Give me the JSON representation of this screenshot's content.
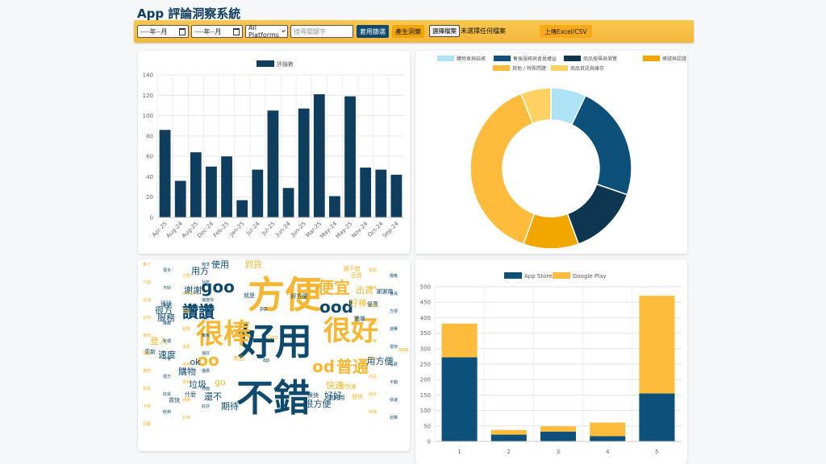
{
  "app": {
    "title": "App 評論洞察系統"
  },
  "toolbar": {
    "date_from": "----年--月",
    "date_to": "----年--月",
    "platform_select": "All Platforms",
    "search_placeholder": "搜尋關鍵字",
    "apply_filter_label": "套用篩選",
    "generate_insight_label": "產生洞察",
    "choose_file_label": "選擇檔案",
    "file_status": "未選擇任何檔案",
    "upload_label": "上傳Excel/CSV"
  },
  "chart_data": [
    {
      "type": "bar",
      "categories": [
        "Apr-25",
        "Aug-24",
        "Aug-25",
        "Dec-24",
        "Feb-25",
        "Jan-25",
        "Jul-24",
        "Jul-25",
        "Jun-24",
        "Jun-25",
        "Mar-25",
        "May-24",
        "May-25",
        "Nov-24",
        "Oct-24",
        "Sep-24"
      ],
      "series": [
        {
          "name": "評論數",
          "values": [
            86,
            36,
            64,
            50,
            60,
            17,
            47,
            105,
            29,
            107,
            121,
            21,
            119,
            49,
            47,
            42
          ]
        }
      ],
      "ylim": [
        0,
        140
      ],
      "yticks": [
        "0",
        "20",
        "40",
        "60",
        "80",
        "100",
        "120",
        "140"
      ],
      "legend": "top",
      "colors": {
        "bar": "#0e3d5e"
      }
    },
    {
      "type": "pie",
      "labels": [
        "購物車與結帳",
        "售後服務與會員權益",
        "商品搜尋與瀏覽",
        "帳號與認證",
        "其他 / 特殊問題",
        "商品資訊與庫存"
      ],
      "values": [
        7,
        23,
        14,
        11,
        38,
        6
      ],
      "colors": [
        "#aee3f5",
        "#0d5079",
        "#0d3750",
        "#f2a600",
        "#ffbb3c",
        "#ffd263"
      ],
      "legend": "top"
    },
    {
      "type": "bar",
      "stacked": true,
      "categories": [
        "1",
        "2",
        "3",
        "4",
        "5"
      ],
      "series": [
        {
          "name": "App Store",
          "values": [
            272,
            22,
            32,
            17,
            155
          ]
        },
        {
          "name": "Google Play",
          "values": [
            109,
            15,
            17,
            44,
            316
          ]
        }
      ],
      "ylim": [
        0,
        500
      ],
      "yticks": [
        "0",
        "50",
        "100",
        "150",
        "200",
        "250",
        "300",
        "350",
        "400",
        "450",
        "500"
      ],
      "legend": "top",
      "colors": {
        "App Store": "#0d5079",
        "Google Play": "#ffbb3c"
      }
    }
  ],
  "wordcloud": {
    "colors": {
      "dark": "#0d4a6d",
      "gold": "#f7b733"
    },
    "words": [
      {
        "t": "不錯",
        "s": 5,
        "c": "dark"
      },
      {
        "t": "好用",
        "s": 5,
        "c": "dark"
      },
      {
        "t": "方便",
        "s": 5,
        "c": "gold"
      },
      {
        "t": "很好",
        "s": 4,
        "c": "gold"
      },
      {
        "t": "很棒",
        "s": 4,
        "c": "gold"
      },
      {
        "t": "讚讚",
        "s": 3,
        "c": "dark"
      },
      {
        "t": "ood",
        "s": 3,
        "c": "dark"
      },
      {
        "t": "oo",
        "s": 3,
        "c": "gold"
      },
      {
        "t": "便宜",
        "s": 3,
        "c": "gold"
      },
      {
        "t": "od",
        "s": 3,
        "c": "gold"
      },
      {
        "t": "普通",
        "s": 3,
        "c": "gold"
      },
      {
        "t": "goo",
        "s": 3,
        "c": "dark"
      },
      {
        "t": "快速",
        "s": 2,
        "c": "gold"
      },
      {
        "t": "ok",
        "s": 2,
        "c": "dark"
      },
      {
        "t": "go",
        "s": 2,
        "c": "gold"
      },
      {
        "t": "謝謝",
        "s": 2,
        "c": "dark"
      },
      {
        "t": "垃圾",
        "s": 2,
        "c": "dark"
      },
      {
        "t": "購物",
        "s": 2,
        "c": "dark"
      },
      {
        "t": "很方",
        "s": 2,
        "c": "dark"
      },
      {
        "t": "好棒",
        "s": 2,
        "c": "gold"
      },
      {
        "t": "用方便",
        "s": 2,
        "c": "dark"
      },
      {
        "t": "服務",
        "s": 2,
        "c": "dark"
      },
      {
        "t": "登入",
        "s": 2,
        "c": "gold"
      },
      {
        "t": "速度",
        "s": 2,
        "c": "dark"
      },
      {
        "t": "還不",
        "s": 2,
        "c": "dark"
      },
      {
        "t": "期待",
        "s": 2,
        "c": "dark"
      },
      {
        "t": "好好",
        "s": 2,
        "c": "dark"
      },
      {
        "t": "很方便",
        "s": 2,
        "c": "dark"
      },
      {
        "t": "出貨",
        "s": 2,
        "c": "gold"
      },
      {
        "t": "使用",
        "s": 2,
        "c": "dark"
      },
      {
        "t": "到貨",
        "s": 2,
        "c": "gold"
      },
      {
        "t": "用方",
        "s": 2,
        "c": "dark"
      },
      {
        "t": "很好用",
        "s": 1,
        "c": "dark"
      },
      {
        "t": "便快速",
        "s": 1,
        "c": "gold"
      },
      {
        "t": "更新",
        "s": 1,
        "c": "dark"
      },
      {
        "t": "優惠",
        "s": 1,
        "c": "dark"
      },
      {
        "t": "商品",
        "s": 1,
        "c": "gold"
      },
      {
        "t": "簡單",
        "s": 1,
        "c": "dark"
      },
      {
        "t": "謝謝商",
        "s": 1,
        "c": "dark"
      },
      {
        "t": "什麼",
        "s": 1,
        "c": "dark"
      },
      {
        "t": "品質",
        "s": 1,
        "c": "gold"
      },
      {
        "t": "很快",
        "s": 1,
        "c": "dark"
      },
      {
        "t": "pp",
        "s": 1,
        "c": "dark"
      },
      {
        "t": "ap",
        "s": 1,
        "c": "dark"
      },
      {
        "t": "Goo",
        "s": 1,
        "c": "gold"
      },
      {
        "t": "便快",
        "s": 1,
        "c": "gold"
      },
      {
        "t": "好方便",
        "s": 1,
        "c": "dark"
      },
      {
        "t": "讚不錯",
        "s": 1,
        "c": "gold"
      },
      {
        "t": "貨快",
        "s": 1,
        "c": "dark"
      },
      {
        "t": "很快",
        "s": 1,
        "c": "dark"
      },
      {
        "t": "就是",
        "s": 1,
        "c": "dark"
      },
      {
        "t": "app",
        "s": 1,
        "c": "gold"
      }
    ],
    "tiny": [
      "推了",
      "很多",
      "付款",
      "物流",
      "客服",
      "價格",
      "介面",
      "不好",
      "找不到",
      "功能",
      "期待",
      "會員",
      "加油",
      "謝謝",
      "活動",
      "速度快",
      "很讚",
      "方便",
      "好用",
      "推薦",
      "點數",
      "好評",
      "超商",
      "運費",
      "東西",
      "折價",
      "退貨",
      "實用",
      "下單",
      "很快",
      "滿意",
      "不會",
      "很棒",
      "還好",
      "可以",
      "喜歡",
      "讚啦",
      "很方",
      "便利",
      "優惠",
      "商品",
      "不錯",
      "看看",
      "好買",
      "網購",
      "頁面",
      "穩定",
      "快速",
      "卡頓",
      "收到",
      "訂單",
      "好評",
      "感謝",
      "划算",
      "回覆"
    ]
  }
}
